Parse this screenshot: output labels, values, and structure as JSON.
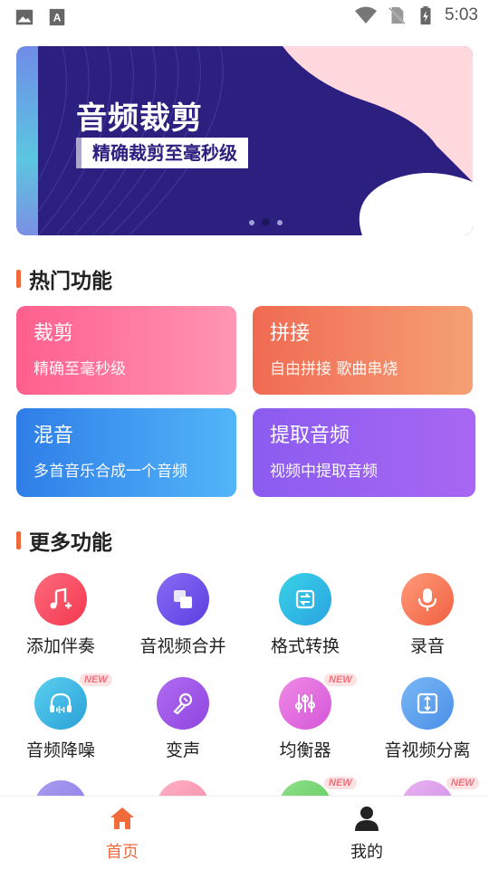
{
  "status_bar": {
    "time": "5:03",
    "left_icons": [
      "image-icon",
      "keyboard-a-icon"
    ],
    "right_icons": [
      "wifi-icon",
      "no-sim-icon",
      "battery-charging-icon"
    ]
  },
  "banner": {
    "title": "音频裁剪",
    "subtitle": "精确裁剪至毫秒级",
    "colors": {
      "background": "#2b1f80",
      "accent": "#ffd9de"
    },
    "page_count": 3,
    "active_page": 2
  },
  "hot_section": {
    "title": "热门功能",
    "cards": [
      {
        "title": "裁剪",
        "subtitle": "精确至毫秒级"
      },
      {
        "title": "拼接",
        "subtitle": "自由拼接 歌曲串烧"
      },
      {
        "title": "混音",
        "subtitle": "多首音乐合成一个音频"
      },
      {
        "title": "提取音频",
        "subtitle": "视频中提取音频"
      }
    ]
  },
  "more_section": {
    "title": "更多功能",
    "items": [
      {
        "label": "添加伴奏",
        "icon": "music-add-icon",
        "new": false
      },
      {
        "label": "音视频合并",
        "icon": "merge-icon",
        "new": false
      },
      {
        "label": "格式转换",
        "icon": "convert-icon",
        "new": false
      },
      {
        "label": "录音",
        "icon": "microphone-icon",
        "new": false
      },
      {
        "label": "音频降噪",
        "icon": "headphones-icon",
        "new": true
      },
      {
        "label": "变声",
        "icon": "voice-change-icon",
        "new": false
      },
      {
        "label": "均衡器",
        "icon": "equalizer-icon",
        "new": true
      },
      {
        "label": "音视频分离",
        "icon": "split-icon",
        "new": false
      }
    ],
    "new_badge": "NEW"
  },
  "bottom_nav": {
    "items": [
      {
        "label": "首页",
        "icon": "home-icon",
        "active": true
      },
      {
        "label": "我的",
        "icon": "person-icon",
        "active": false
      }
    ],
    "active_color": "#f06a3c"
  }
}
